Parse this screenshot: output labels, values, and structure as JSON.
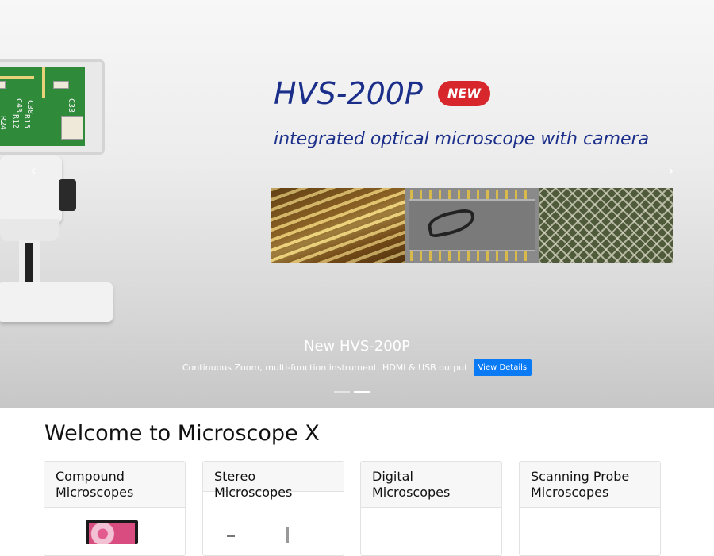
{
  "carousel": {
    "hero_title": "HVS-200P",
    "badge": "NEW",
    "hero_subtitle": "integrated optical microscope with camera",
    "pcb_labels": [
      "C43",
      "C38",
      "C33",
      "R15",
      "R12",
      "R24"
    ],
    "caption_title": "New HVS-200P",
    "caption_text": "Continuous Zoom, multi-function instrument, HDMI & USB output",
    "button_label": "View Details",
    "prev_glyph": "‹",
    "next_glyph": "›",
    "slide_count": 2,
    "active_slide": 2
  },
  "main": {
    "heading": "Welcome to Microscope X",
    "cards": [
      {
        "title": "Compound Microscopes"
      },
      {
        "title": "Stereo Microscopes"
      },
      {
        "title": "Digital Microscopes"
      },
      {
        "title": "Scanning Probe Microscopes"
      }
    ]
  },
  "colors": {
    "hero_text": "#1b2f8a",
    "badge": "#d7262c",
    "button": "#0a7bf5"
  }
}
